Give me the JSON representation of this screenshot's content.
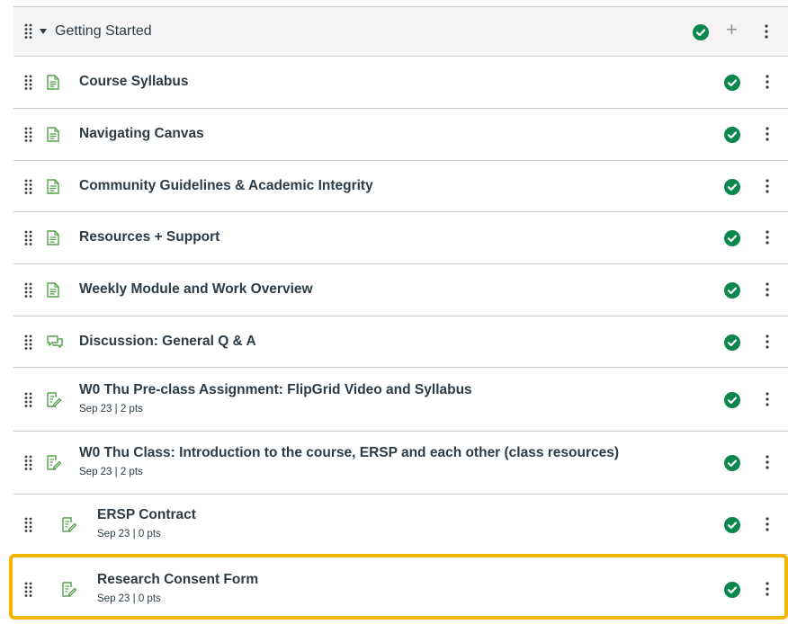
{
  "module": {
    "title": "Getting Started",
    "status_icon": "published-check-icon",
    "add_icon": "plus-icon",
    "menu_icon": "kebab-menu-icon"
  },
  "items": [
    {
      "title": "Course Syllabus",
      "type": "page",
      "meta": ""
    },
    {
      "title": "Navigating Canvas",
      "type": "page",
      "meta": ""
    },
    {
      "title": "Community Guidelines & Academic Integrity",
      "type": "page",
      "meta": ""
    },
    {
      "title": "Resources + Support",
      "type": "page",
      "meta": ""
    },
    {
      "title": "Weekly Module and Work Overview",
      "type": "page",
      "meta": ""
    },
    {
      "title": "Discussion: General Q & A",
      "type": "discussion",
      "meta": ""
    },
    {
      "title": "W0 Thu Pre-class Assignment: FlipGrid Video and Syllabus",
      "type": "assignment",
      "meta": "Sep 23  |  2 pts"
    },
    {
      "title": "W0 Thu Class: Introduction to the course, ERSP and each other (class resources)",
      "type": "assignment",
      "meta": "Sep 23  |  2 pts"
    },
    {
      "title": "ERSP Contract",
      "type": "assignment",
      "meta": "Sep 23  |  0 pts"
    },
    {
      "title": "Research Consent Form",
      "type": "assignment",
      "meta": "Sep 23  |  0 pts"
    }
  ],
  "colors": {
    "published_green": "#0b874b",
    "icon_green": "#56a14c",
    "highlight_yellow": "#f5b400"
  }
}
